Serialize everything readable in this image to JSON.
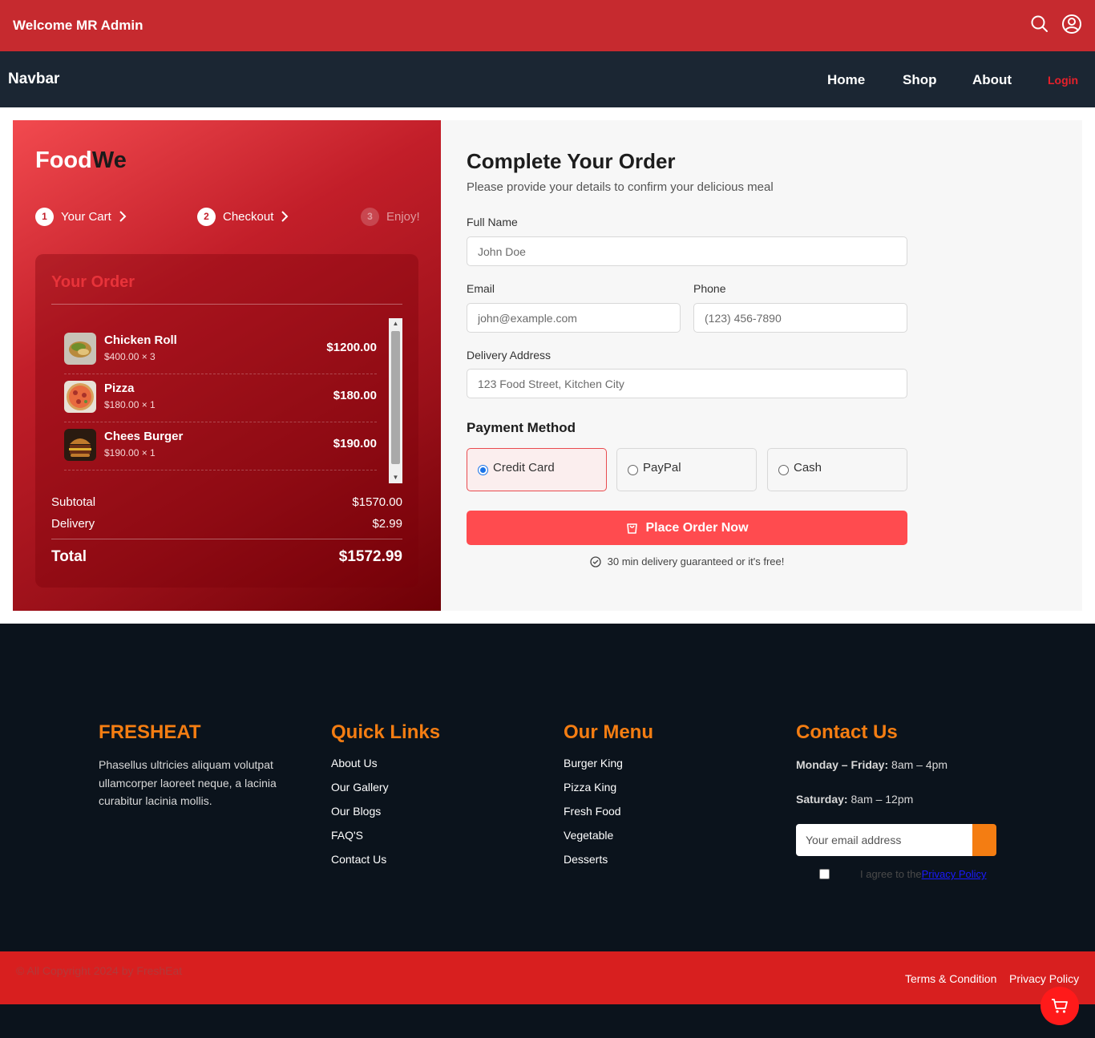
{
  "topbar": {
    "welcome": "Welcome MR Admin",
    "icons": [
      "search-icon",
      "user-icon"
    ]
  },
  "navbar": {
    "brand": "Navbar",
    "links": [
      "Home",
      "Shop",
      "About"
    ],
    "login": "Login"
  },
  "brand": {
    "part1": "Food",
    "part2": "We"
  },
  "steps": [
    {
      "num": "1",
      "label": "Your Cart"
    },
    {
      "num": "2",
      "label": "Checkout"
    },
    {
      "num": "3",
      "label": "Enjoy!"
    }
  ],
  "order": {
    "title": "Your Order",
    "items": [
      {
        "name": "Chicken Roll",
        "detail": "$400.00 × 3",
        "price": "$1200.00",
        "icon": "chicken-roll-image"
      },
      {
        "name": "Pizza",
        "detail": "$180.00 × 1",
        "price": "$180.00",
        "icon": "pizza-image"
      },
      {
        "name": "Chees Burger",
        "detail": "$190.00 × 1",
        "price": "$190.00",
        "icon": "burger-image"
      }
    ],
    "subtotal_label": "Subtotal",
    "subtotal": "$1570.00",
    "delivery_label": "Delivery",
    "delivery": "$2.99",
    "total_label": "Total",
    "total": "$1572.99"
  },
  "form": {
    "title": "Complete Your Order",
    "subtitle": "Please provide your details to confirm your delicious meal",
    "full_name_label": "Full Name",
    "full_name_placeholder": "John Doe",
    "email_label": "Email",
    "email_placeholder": "john@example.com",
    "phone_label": "Phone",
    "phone_placeholder": "(123) 456-7890",
    "address_label": "Delivery Address",
    "address_placeholder": "123 Food Street, Kitchen City",
    "payment_title": "Payment Method",
    "payment_options": [
      "Credit Card",
      "PayPal",
      "Cash"
    ],
    "payment_selected": "Credit Card",
    "submit": "Place Order Now",
    "guarantee": "30 min delivery guaranteed or it's free!"
  },
  "footer": {
    "about_title": "FRESHEAT",
    "about_text": "Phasellus ultricies aliquam volutpat ullamcorper laoreet neque, a lacinia curabitur lacinia mollis.",
    "links_title": "Quick Links",
    "links": [
      "About Us",
      "Our Gallery",
      "Our Blogs",
      "FAQ'S",
      "Contact Us"
    ],
    "menu_title": "Our Menu",
    "menu": [
      "Burger King",
      "Pizza King",
      "Fresh Food",
      "Vegetable",
      "Desserts"
    ],
    "contact_title": "Contact Us",
    "hours1_label": "Monday – Friday:",
    "hours1": "8am – 4pm",
    "hours2_label": "Saturday:",
    "hours2": "8am – 12pm",
    "email_placeholder": "Your email address",
    "agree_text": "I agree to the",
    "agree_link": "Privacy Policy",
    "copyright": "© All Copyright 2024 by FreshEat",
    "bottom_links": [
      "Terms & Condition",
      "Privacy Policy"
    ]
  },
  "colors": {
    "brand_red": "#c62a2f",
    "accent_orange": "#f47d12",
    "button_red": "#ff4b4f",
    "navbar": "#1b2633"
  }
}
